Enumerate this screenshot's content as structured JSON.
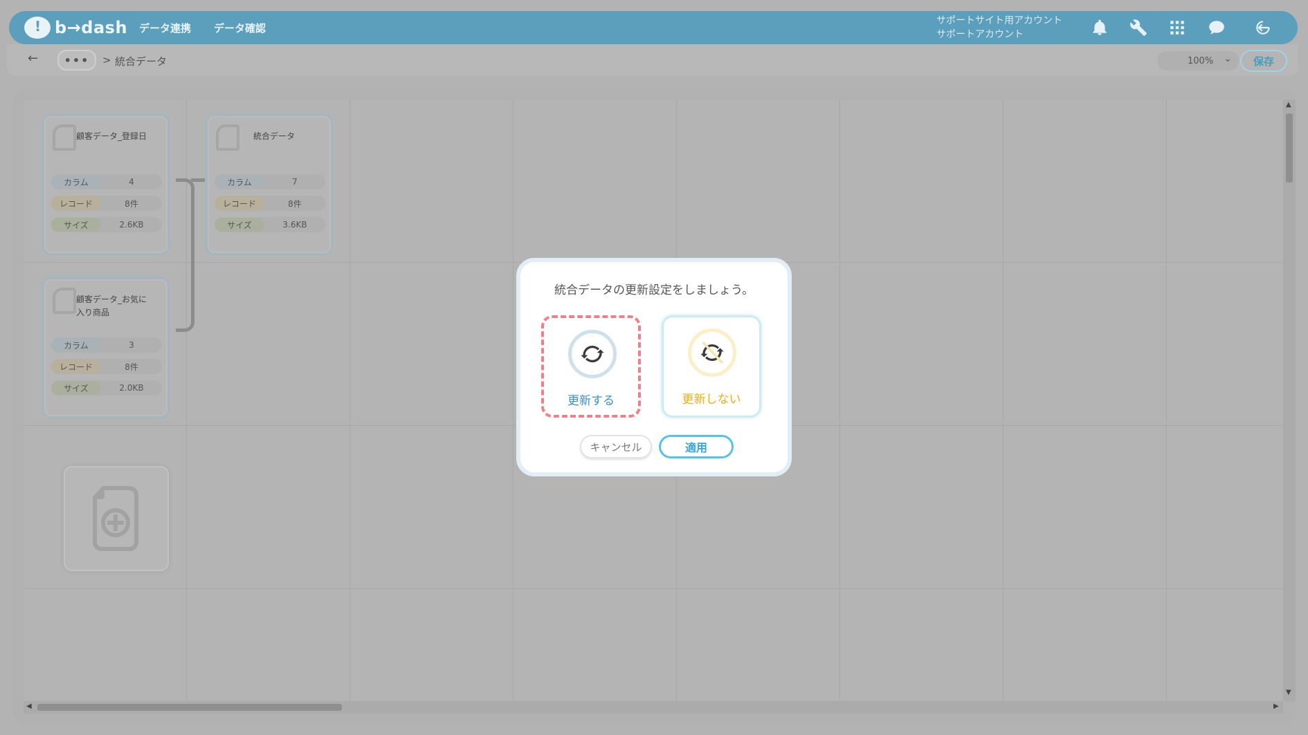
{
  "app": {
    "logo_text": "b→dash",
    "nav": [
      "データ連携",
      "データ確認"
    ],
    "account_line1": "サポートサイト用アカウント",
    "account_line2": "サポートアカウント",
    "header_icons": [
      "bell-icon",
      "wrench-icon",
      "grid-icon",
      "chat-icon",
      "logout-icon"
    ],
    "accent_color": "#5b9fbd"
  },
  "toolbar": {
    "back_symbol": "←",
    "dots": "•••",
    "separator": ">",
    "current": "統合データ",
    "zoom": "100%",
    "save_label": "保存"
  },
  "cards": [
    {
      "title": "顧客データ_登録日",
      "stats": [
        {
          "label": "カラム",
          "value": "4"
        },
        {
          "label": "レコード",
          "value": "8件"
        },
        {
          "label": "サイズ",
          "value": "2.6KB"
        }
      ]
    },
    {
      "title": "統合データ",
      "stats": [
        {
          "label": "カラム",
          "value": "7"
        },
        {
          "label": "レコード",
          "value": "8件"
        },
        {
          "label": "サイズ",
          "value": "3.6KB"
        }
      ]
    },
    {
      "title": "顧客データ_お気に入り商品",
      "stats": [
        {
          "label": "カラム",
          "value": "3"
        },
        {
          "label": "レコード",
          "value": "8件"
        },
        {
          "label": "サイズ",
          "value": "2.0KB"
        }
      ]
    }
  ],
  "modal": {
    "title": "統合データの更新設定をしましょう。",
    "option_update": "更新する",
    "option_no_update": "更新しない",
    "cancel_label": "キャンセル",
    "apply_label": "適用"
  }
}
